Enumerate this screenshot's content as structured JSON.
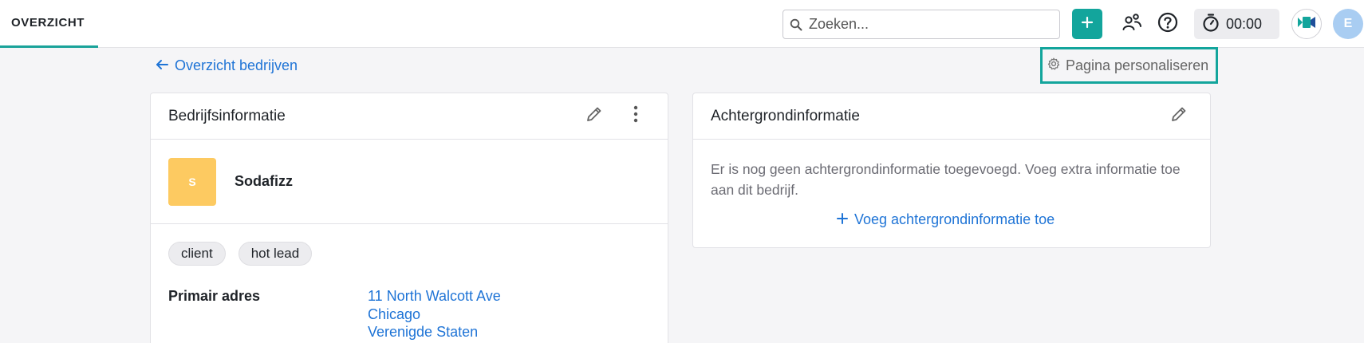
{
  "nav": {
    "tab_overview": "OVERZICHT"
  },
  "search": {
    "placeholder": "Zoeken..."
  },
  "timer": {
    "value": "00:00"
  },
  "user": {
    "initial": "E"
  },
  "breadcrumb": {
    "back_label": "Overzicht bedrijven"
  },
  "personalize": {
    "label": "Pagina personaliseren"
  },
  "company_card": {
    "title": "Bedrijfsinformatie",
    "logo_initial": "S",
    "name": "Sodafizz",
    "tags": [
      "client",
      "hot lead"
    ],
    "address_label": "Primair adres",
    "address_lines": [
      "11 North Walcott Ave",
      "Chicago",
      "Verenigde Staten"
    ]
  },
  "background_card": {
    "title": "Achtergrondinformatie",
    "empty_text": "Er is nog geen achtergrondinformatie toegevoegd. Voeg extra informatie toe aan dit bedrijf.",
    "add_label": "Voeg achtergrondinformatie toe"
  },
  "colors": {
    "accent": "#13a59c",
    "link": "#1f74d6",
    "logo": "#fdca61",
    "avatar": "#a9cdf2"
  },
  "icons": [
    "search-icon",
    "plus-icon",
    "people-icon",
    "help-icon",
    "stopwatch-icon",
    "video-icon",
    "arrow-left-icon",
    "gear-icon",
    "pencil-icon",
    "more-vertical-icon"
  ]
}
